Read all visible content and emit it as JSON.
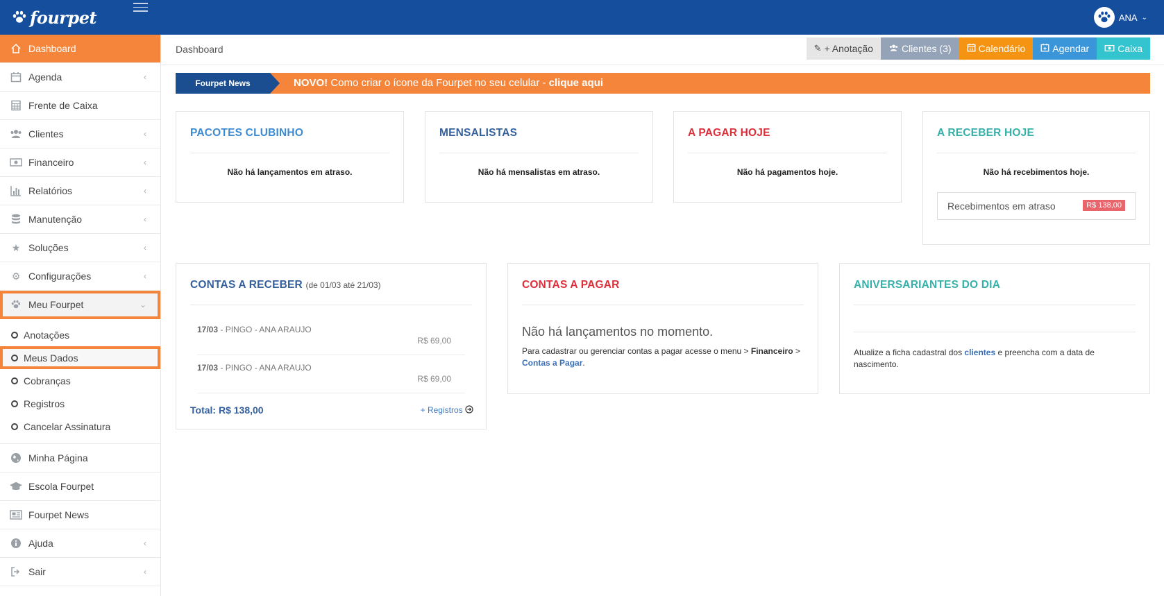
{
  "header": {
    "brand": "fourpet",
    "user_name": "ANA"
  },
  "sidebar": {
    "items": [
      {
        "label": "Dashboard",
        "icon": "home-icon"
      },
      {
        "label": "Agenda",
        "icon": "calendar-icon"
      },
      {
        "label": "Frente de Caixa",
        "icon": "calculator-icon"
      },
      {
        "label": "Clientes",
        "icon": "users-icon"
      },
      {
        "label": "Financeiro",
        "icon": "money-icon"
      },
      {
        "label": "Relatórios",
        "icon": "bar-chart-icon"
      },
      {
        "label": "Manutenção",
        "icon": "database-icon"
      },
      {
        "label": "Soluções",
        "icon": "star-icon"
      },
      {
        "label": "Configurações",
        "icon": "gears-icon"
      },
      {
        "label": "Meu Fourpet",
        "icon": "paw-icon"
      }
    ],
    "sub_items": [
      "Anotações",
      "Meus Dados",
      "Cobranças",
      "Registros",
      "Cancelar Assinatura"
    ],
    "bottom_items": [
      {
        "label": "Minha Página",
        "icon": "globe-icon"
      },
      {
        "label": "Escola Fourpet",
        "icon": "graduation-cap-icon"
      },
      {
        "label": "Fourpet News",
        "icon": "newspaper-icon"
      },
      {
        "label": "Ajuda",
        "icon": "info-icon"
      },
      {
        "label": "Sair",
        "icon": "sign-out-icon"
      }
    ]
  },
  "breadcrumb": "Dashboard",
  "actions": {
    "anotacao": "+ Anotação",
    "clientes": "Clientes (3)",
    "calendario": "Calendário",
    "agendar": "Agendar",
    "caixa": "Caixa"
  },
  "news": {
    "tag": "Fourpet News",
    "highlight": "NOVO!",
    "text": " Como criar o ícone da Fourpet no seu celular - ",
    "link": "clique aqui"
  },
  "cards": {
    "pacotes": {
      "title": "PACOTES CLUBINHO",
      "empty": "Não há lançamentos em atraso."
    },
    "mensalistas": {
      "title": "MENSALISTAS",
      "empty": "Não há mensalistas em atraso."
    },
    "pagar_hoje": {
      "title": "A PAGAR HOJE",
      "empty": "Não há pagamentos hoje."
    },
    "receber_hoje": {
      "title": "A RECEBER HOJE",
      "empty": "Não há recebimentos hoje.",
      "late_label": "Recebimentos em atraso",
      "late_value": "R$ 138,00"
    },
    "contas_receber": {
      "title": "CONTAS A RECEBER",
      "subtitle": "(de 01/03 até 21/03)",
      "rows": [
        {
          "date": "17/03",
          "desc": " - PINGO - ANA ARAUJO",
          "amount": "R$ 69,00"
        },
        {
          "date": "17/03",
          "desc": " - PINGO - ANA ARAUJO",
          "amount": "R$ 69,00"
        }
      ],
      "total": "Total: R$ 138,00",
      "more": "+ Registros"
    },
    "contas_pagar": {
      "title": "CONTAS A PAGAR",
      "empty": "Não há lançamentos no momento.",
      "note_pre": "Para cadastrar ou gerenciar contas a pagar acesse o menu > ",
      "note_menu": "Financeiro",
      "note_mid": " > ",
      "note_link": "Contas a Pagar",
      "note_end": "."
    },
    "aniversariantes": {
      "title": "ANIVERSARIANTES DO DIA",
      "note_pre": "Atualize a ficha cadastral dos ",
      "note_link": "clientes",
      "note_end": " e preencha com a data de nascimento."
    }
  },
  "colors": {
    "topbar": "#164e9e",
    "accent": "#f5853a",
    "news_tag": "#1b4d91"
  }
}
